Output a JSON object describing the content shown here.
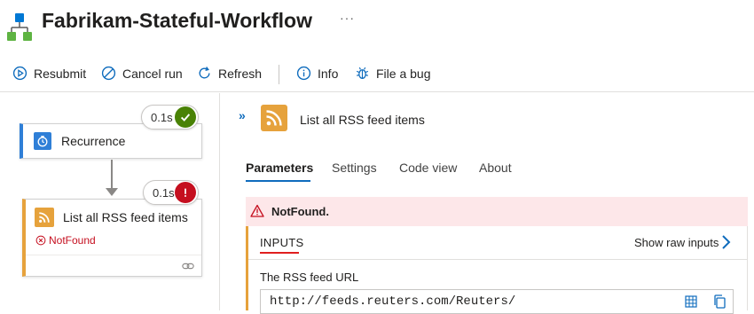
{
  "header": {
    "title": "Fabrikam-Stateful-Workflow",
    "more": "···",
    "icon": "workflow-icon"
  },
  "toolbar": {
    "resubmit": "Resubmit",
    "cancel_run": "Cancel run",
    "refresh": "Refresh",
    "info": "Info",
    "file_bug": "File a bug"
  },
  "canvas": {
    "recurrence": {
      "title": "Recurrence",
      "duration": "0.1s",
      "status": "success",
      "accent": "#2f7fd7"
    },
    "rss": {
      "title": "List all RSS feed items",
      "duration": "0.1s",
      "status": "error",
      "error_text": "NotFound",
      "accent": "#e6a23c"
    }
  },
  "details": {
    "expand": "»",
    "title": "List all RSS feed items",
    "tabs": [
      "Parameters",
      "Settings",
      "Code view",
      "About"
    ],
    "active_tab": "Parameters",
    "error": "NotFound.",
    "inputs_label": "INPUTS",
    "show_raw": "Show raw inputs",
    "field_label": "The RSS feed URL",
    "field_value": "http://feeds.reuters.com/Reuters/"
  },
  "colors": {
    "success": "#498205",
    "error": "#c50f1f",
    "accent_blue": "#0f6cbd",
    "rss": "#e6a23c"
  }
}
